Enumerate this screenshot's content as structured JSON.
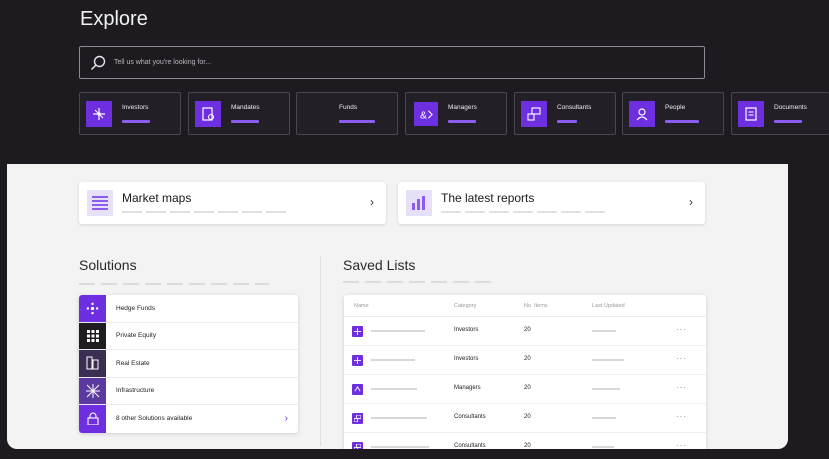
{
  "page": {
    "title": "Explore"
  },
  "search": {
    "placeholder": "Tell us what you're looking for..."
  },
  "categories": [
    {
      "label": "Investors",
      "icon": "investors-icon"
    },
    {
      "label": "Mandates",
      "icon": "mandates-icon"
    },
    {
      "label": "Funds",
      "icon": ""
    },
    {
      "label": "Managers",
      "icon": "managers-icon"
    },
    {
      "label": "Consultants",
      "icon": "consultants-icon"
    },
    {
      "label": "People",
      "icon": "people-icon"
    },
    {
      "label": "Documents",
      "icon": "documents-icon"
    }
  ],
  "cards": [
    {
      "title": "Market maps",
      "icon": "list-icon"
    },
    {
      "title": "The latest reports",
      "icon": "bar-chart-icon"
    }
  ],
  "solutions": {
    "title": "Solutions",
    "items": [
      {
        "label": "Hedge Funds",
        "icon": "hedge-funds-icon",
        "color": "#6e2fe0"
      },
      {
        "label": "Private Equity",
        "icon": "private-equity-icon",
        "color": "#1f1d22"
      },
      {
        "label": "Real Estate",
        "icon": "real-estate-icon",
        "color": "#3a2f52"
      },
      {
        "label": "Infrastructure",
        "icon": "infrastructure-icon",
        "color": "#5a3aa0"
      },
      {
        "label": "8 other Solutions available",
        "icon": "lock-icon",
        "color": "#6e2fe0"
      }
    ]
  },
  "saved_lists": {
    "title": "Saved Lists",
    "columns": [
      "Name",
      "Category",
      "No. Items",
      "Last Updated"
    ],
    "rows": [
      {
        "category": "Investors",
        "items": "20",
        "more": "···"
      },
      {
        "category": "Investors",
        "items": "20",
        "more": "···"
      },
      {
        "category": "Managers",
        "items": "20",
        "more": "···"
      },
      {
        "category": "Consultants",
        "items": "20",
        "more": "···"
      },
      {
        "category": "Consultants",
        "items": "20",
        "more": "···"
      }
    ]
  },
  "colors": {
    "accent": "#6e2fe0",
    "accent_light": "#8c5cf0",
    "background": "#1d1b1f",
    "panel": "#f3f3f4"
  }
}
